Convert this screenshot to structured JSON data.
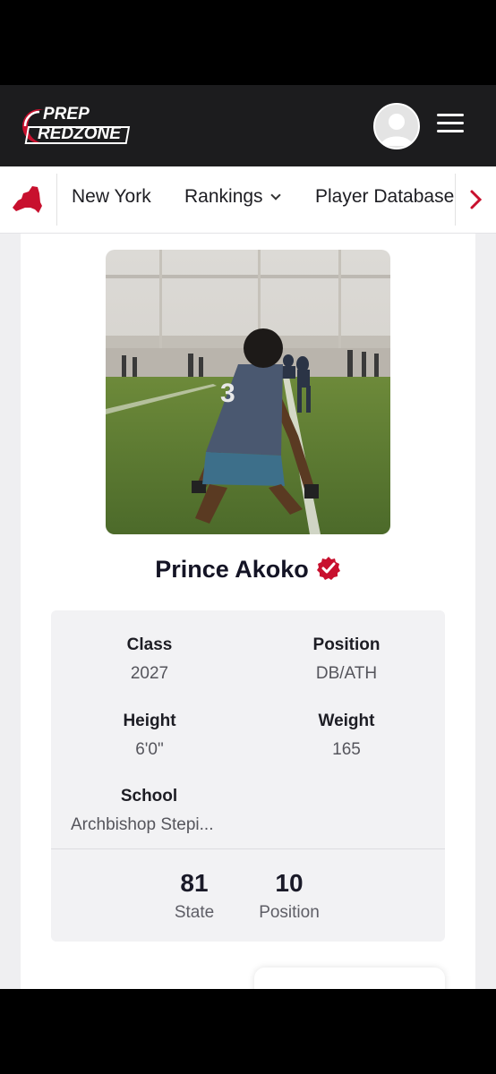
{
  "header": {
    "logo_line1": "PREP",
    "logo_line2": "REDZONE",
    "avatar_icon": "user-avatar-icon",
    "menu_icon": "hamburger-menu-icon"
  },
  "subnav": {
    "state_icon": "new-york-state-icon",
    "items": [
      {
        "label": "New York"
      },
      {
        "label": "Rankings"
      },
      {
        "label": "Player Database"
      }
    ],
    "next_icon": "chevron-right-icon"
  },
  "player": {
    "name": "Prince Akoko",
    "verified_icon": "verified-badge-icon",
    "jersey_number": "3",
    "class_label": "Class",
    "class_value": "2027",
    "position_label": "Position",
    "position_value": "DB/ATH",
    "height_label": "Height",
    "height_value": "6'0\"",
    "weight_label": "Weight",
    "weight_value": "165",
    "school_label": "School",
    "school_value": "Archbishop Stepi..."
  },
  "rankings": [
    {
      "value": "81",
      "label": "State"
    },
    {
      "value": "10",
      "label": "Position"
    }
  ],
  "colors": {
    "brand_red": "#c8102e",
    "header_bg": "#1c1c1e"
  }
}
